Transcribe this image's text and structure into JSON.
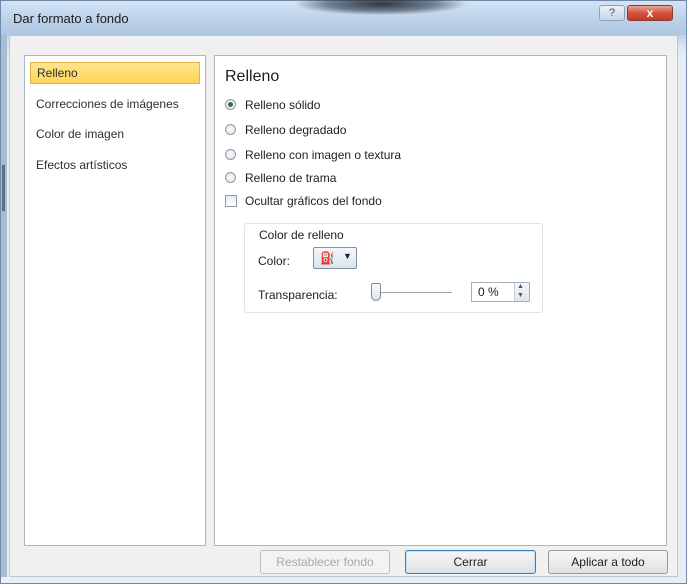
{
  "window": {
    "title": "Dar formato a fondo",
    "help_icon": "?",
    "close_icon": "x"
  },
  "sidebar": {
    "items": [
      {
        "label": "Relleno",
        "selected": true
      },
      {
        "label": "Correcciones de imágenes",
        "selected": false
      },
      {
        "label": "Color de imagen",
        "selected": false
      },
      {
        "label": "Efectos artísticos",
        "selected": false
      }
    ]
  },
  "panel": {
    "heading": "Relleno",
    "options": [
      {
        "label": "Relleno sólido",
        "checked": true
      },
      {
        "label": "Relleno degradado",
        "checked": false
      },
      {
        "label": "Relleno con imagen o textura",
        "checked": false
      },
      {
        "label": "Relleno de trama",
        "checked": false
      }
    ],
    "hide_graphics": {
      "label": "Ocultar gráficos del fondo",
      "checked": false
    },
    "fill_color": {
      "group_label": "Color de relleno",
      "color_label": "Color:",
      "color_icon": "paint-bucket",
      "transparency_label": "Transparencia:",
      "transparency_value": "0 %",
      "transparency_level": 0
    }
  },
  "buttons": {
    "reset": "Restablecer fondo",
    "close": "Cerrar",
    "apply_all": "Aplicar a todo"
  },
  "colors": {
    "selection": "#ffd458",
    "close_button": "#d4533e"
  }
}
